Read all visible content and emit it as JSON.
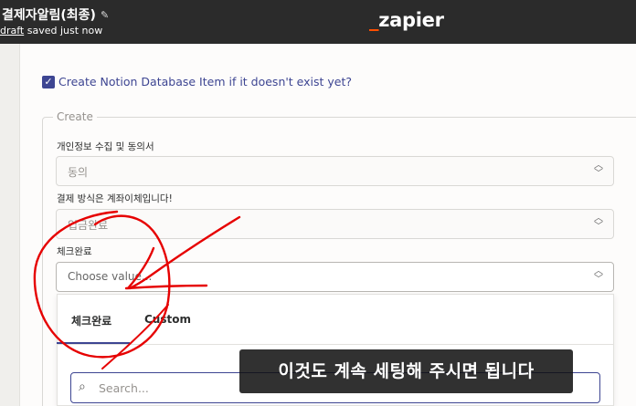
{
  "header": {
    "zap_title": "결제자알림(최종)",
    "status_link": "draft",
    "status_text": "saved just now",
    "logo_text": "zapier",
    "logo_mark": "_"
  },
  "form": {
    "checkbox_label": "Create Notion Database Item if it doesn't exist yet?",
    "checkbox_checked": true,
    "section_legend": "Create",
    "fields": [
      {
        "label": "개인정보 수집 및 동의서",
        "value": "동의"
      },
      {
        "label": "결제 방식은 계좌이체입니다!",
        "value": "입금완료"
      },
      {
        "label": "체크완료",
        "placeholder": "Choose value..."
      }
    ]
  },
  "dropdown": {
    "tabs": [
      "체크완료",
      "Custom"
    ],
    "active_tab": "체크완료",
    "search_placeholder": "Search..."
  },
  "caption": "이것도 계속 세팅해 주시면 됩니다",
  "colors": {
    "accent": "#3d4592",
    "zapier_orange": "#ff4f00",
    "topbar": "#2b2b2b",
    "annotation_red": "#e60000"
  },
  "icons": [
    "pencil-icon",
    "check-icon",
    "chevron-updown-icon",
    "search-icon"
  ]
}
